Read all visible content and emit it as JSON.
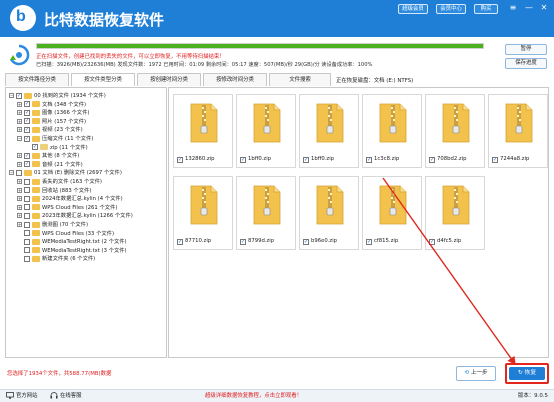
{
  "app": {
    "title": "比特数据恢复软件",
    "logo_letter": "b"
  },
  "titlebar": {
    "vip_button": "超级会员",
    "user_center_button": "会员中心",
    "buy_button": "购买",
    "menu_icon": "≡",
    "minimize_icon": "—",
    "close_icon": "✕"
  },
  "scan": {
    "progress_percent": 100,
    "status_line": "正在扫描文件，创建已找到的丢失的文件，可以立即恢复，不用等待扫描结束！",
    "stats": "已扫描：3926(MB)/232636(MB)  发现文件数：1972  已用时间：01:09  剩余时间：05:17  速度：507(MB)/秒  29(GB)/分  读设备成功率：100%",
    "pause_button": "暂停",
    "save_button": "保存进度"
  },
  "tabs": [
    {
      "label": "按文件路径分类",
      "active": false
    },
    {
      "label": "按文件类型分类",
      "active": true
    },
    {
      "label": "按创建时间分类",
      "active": false
    },
    {
      "label": "按修改时间分类",
      "active": false
    },
    {
      "label": "文件搜索",
      "active": false
    }
  ],
  "current_position": "正在恢复磁盘：文档 (E:) NTFS)",
  "tree": [
    {
      "level": 0,
      "exp": "−",
      "checked": true,
      "label": "00 找到的文件 (1934 个文件)",
      "zip": false
    },
    {
      "level": 1,
      "exp": "+",
      "checked": true,
      "label": "文档  (348 个文件)",
      "zip": false
    },
    {
      "level": 1,
      "exp": "+",
      "checked": true,
      "label": "图像  (1366 个文件)",
      "zip": false
    },
    {
      "level": 1,
      "exp": "+",
      "checked": true,
      "label": "照片  (157 个文件)",
      "zip": false
    },
    {
      "level": 1,
      "exp": "+",
      "checked": true,
      "label": "视频  (23 个文件)",
      "zip": false
    },
    {
      "level": 1,
      "exp": "−",
      "checked": true,
      "label": "压缩文件  (11 个文件)",
      "zip": false
    },
    {
      "level": 2,
      "exp": "",
      "checked": true,
      "label": "zip  (11 个文件)",
      "zip": true
    },
    {
      "level": 1,
      "exp": "+",
      "checked": true,
      "label": "其他  (8 个文件)",
      "zip": false
    },
    {
      "level": 1,
      "exp": "+",
      "checked": true,
      "label": "音频  (21 个文件)",
      "zip": false
    },
    {
      "level": 0,
      "exp": "−",
      "checked": false,
      "label": "01 文档 (E) 删除文件 (2697 个文件)",
      "zip": false
    },
    {
      "level": 1,
      "exp": "+",
      "checked": false,
      "label": "丢失的文件  (163 个文件)",
      "zip": false
    },
    {
      "level": 1,
      "exp": "+",
      "checked": false,
      "label": "回收站  (883 个文件)",
      "zip": false
    },
    {
      "level": 1,
      "exp": "+",
      "checked": false,
      "label": "2024年数据汇总.kylin  (4 个文件)",
      "zip": false
    },
    {
      "level": 1,
      "exp": "+",
      "checked": false,
      "label": "WPS Cloud Files  (261 个文件)",
      "zip": false
    },
    {
      "level": 1,
      "exp": "+",
      "checked": false,
      "label": "2023年数据汇总.kylin  (1266 个文件)",
      "zip": false
    },
    {
      "level": 1,
      "exp": "+",
      "checked": false,
      "label": "删测图  (70 个文件)",
      "zip": false
    },
    {
      "level": 1,
      "exp": "",
      "checked": false,
      "label": "WPS Cloud Files  (33 个文件)",
      "zip": false
    },
    {
      "level": 1,
      "exp": "",
      "checked": false,
      "label": "WEMediaTestRight.txt  (2 个文件)",
      "zip": false
    },
    {
      "level": 1,
      "exp": "",
      "checked": false,
      "label": "WEMediaTestRight.txt  (3 个文件)",
      "zip": false
    },
    {
      "level": 1,
      "exp": "",
      "checked": false,
      "label": "新建文件夹  (6 个文件)",
      "zip": false
    }
  ],
  "files": [
    {
      "name": "132860.zip",
      "checked": true
    },
    {
      "name": "1bff0.zip",
      "checked": true
    },
    {
      "name": "1bff0.zip",
      "checked": true
    },
    {
      "name": "1c3c8.zip",
      "checked": true
    },
    {
      "name": "708bd2.zip",
      "checked": true
    },
    {
      "name": "7244a8.zip",
      "checked": true
    },
    {
      "name": "87710.zip",
      "checked": true
    },
    {
      "name": "8799d.zip",
      "checked": true
    },
    {
      "name": "b96e0.zip",
      "checked": true
    },
    {
      "name": "cf815.zip",
      "checked": true
    },
    {
      "name": "d4fc5.zip",
      "checked": true
    }
  ],
  "bottom": {
    "selection_info": "您选择了1934个文件，共588.77(MB)数据",
    "prev_button": "上一步",
    "recover_button": "恢复"
  },
  "footer": {
    "website": "官方网站",
    "online_service": "在线客服",
    "promo": "超级详细数据恢复教程，点击立即观看！",
    "version": "版本：9.0.5"
  },
  "colors": {
    "accent": "#1f7fd6",
    "highlight": "#e0281e",
    "progress": "#4cb11e"
  }
}
